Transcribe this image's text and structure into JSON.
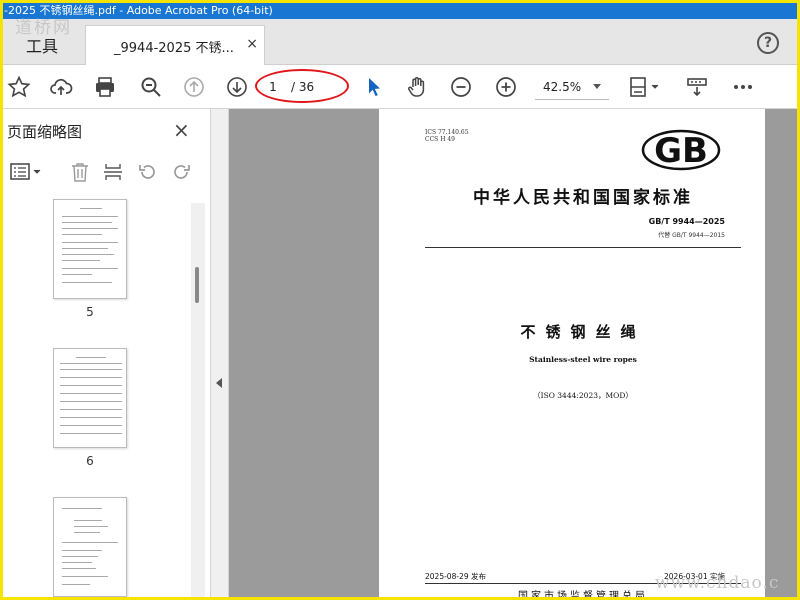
{
  "window": {
    "title": "-2025 不锈钢丝绳.pdf - Adobe Acrobat Pro (64-bit)"
  },
  "watermarks": {
    "top_left": "道桥网",
    "bottom_right": "www.chdao.c"
  },
  "tabs": {
    "tools_label": "工具",
    "doc_label": "_9944-2025 不锈...",
    "close_glyph": "×",
    "help_glyph": "?"
  },
  "toolbar": {
    "current_page": "1",
    "total_pages": "/ 36",
    "zoom": "42.5%"
  },
  "panel": {
    "title": "页面缩略图",
    "close_glyph": "×",
    "thumbnails": [
      {
        "label": "5"
      },
      {
        "label": "6"
      }
    ]
  },
  "document": {
    "ics": "ICS 77.140.65",
    "ccs": "CCS H 49",
    "logo_text": "GB",
    "standard_title": "中华人民共和国国家标准",
    "code": "GB/T 9944—2025",
    "replaces": "代替 GB/T 9944—2015",
    "cn_name": "不锈钢丝绳",
    "en_name": "Stainless-steel wire ropes",
    "iso_ref": "（ISO 3444:2023，MOD）",
    "publish_date": "2025-08-29 发布",
    "implement_date": "2026-03-01 实施",
    "issuer": "国家市场监督管理总局"
  },
  "colors": {
    "title_bar": "#1976d2",
    "outer_border": "#f4e400",
    "annotation_red": "#e0161b",
    "select_tool": "#1565c0",
    "viewport_gray": "#9b9b9b"
  }
}
